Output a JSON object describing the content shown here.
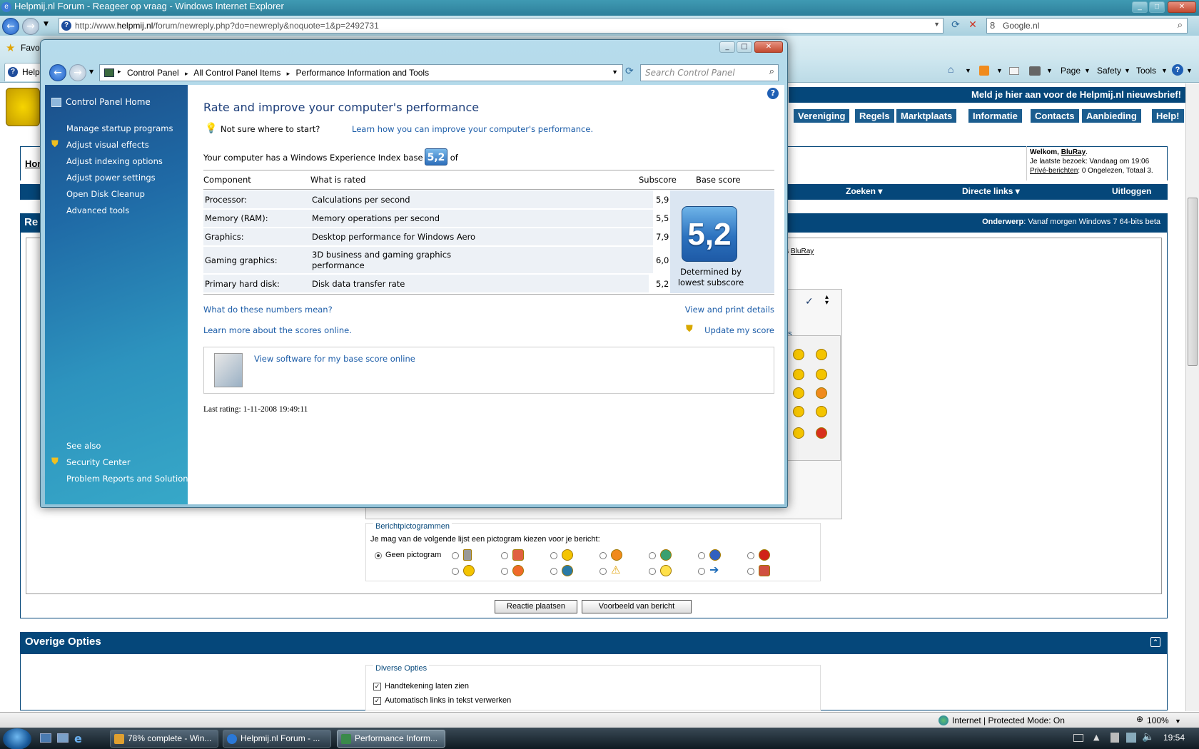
{
  "browser": {
    "title": "Helpmij.nl Forum - Reageer op vraag - Windows Internet Explorer",
    "url_prefix": "http://www.",
    "url_domain": "helpmij.nl",
    "url_path": "/forum/newreply.php?do=newreply&noquote=1&p=2492731",
    "search_value": "Google.nl",
    "favorites_label": "Favorites",
    "tab_label": "Helpmij",
    "commands": [
      "Page",
      "Safety",
      "Tools"
    ],
    "status_zone": "Internet | Protected Mode: On",
    "zoom": "100%"
  },
  "forum": {
    "banner": "Meld je hier aan voor de Helpmij.nl nieuwsbrief!",
    "nav": [
      "Vereniging",
      "Regels",
      "Marktplaats",
      "Informatie",
      "Contacts",
      "Aanbieding",
      "Help!"
    ],
    "home_crumb": "Hor",
    "welcome_prefix": "Welkom,",
    "welcome_user": "BluRay",
    "welcome_line2": "Je laatste bezoek: Vandaag om 19:06",
    "welcome_pm": "Privé-berichten",
    "welcome_pm_rest": ": 0 Ongelezen, Totaal 3.",
    "linkbar": [
      "Zoeken",
      "Directe links",
      "Uitloggen"
    ],
    "reply_head_left": "Re",
    "subject_label": "Onderwerp",
    "subject_value": ": Vanaf morgen Windows 7 64-bits beta",
    "is_label": "is",
    "is_user": "BluRay",
    "smilies_label": "es",
    "icons_legend": "Berichtpictogrammen",
    "icons_text": "Je mag van de volgende lijst een pictogram kiezen voor je bericht:",
    "no_icon": "Geen pictogram",
    "btn_post": "Reactie plaatsen",
    "btn_preview": "Voorbeeld van bericht",
    "options_head": "Overige Opties",
    "diverse_legend": "Diverse Opties",
    "opt1": "Handtekening laten zien",
    "opt2": "Automatisch links in tekst verwerken"
  },
  "controlpanel": {
    "breadcrumb": [
      "Control Panel",
      "All Control Panel Items",
      "Performance Information and Tools"
    ],
    "search_placeholder": "Search Control Panel",
    "left_home": "Control Panel Home",
    "left_tasks": [
      "Manage startup programs",
      "Adjust visual effects",
      "Adjust indexing options",
      "Adjust power settings",
      "Open Disk Cleanup",
      "Advanced tools"
    ],
    "see_also": "See also",
    "see_also_links": [
      "Security Center",
      "Problem Reports and Solutions"
    ],
    "heading": "Rate and improve your computer's performance",
    "tip_text": "Not sure where to start?",
    "tip_link": "Learn how you can improve your computer's performance.",
    "base_text": "Your computer has a Windows Experience Index base score of",
    "base_score": "5,2",
    "col_component": "Component",
    "col_rated": "What is rated",
    "col_subscore": "Subscore",
    "col_base": "Base score",
    "rows": [
      {
        "component": "Processor:",
        "rated": "Calculations per second",
        "rated2": "",
        "subscore": "5,9"
      },
      {
        "component": "Memory (RAM):",
        "rated": "Memory operations per second",
        "rated2": "",
        "subscore": "5,5"
      },
      {
        "component": "Graphics:",
        "rated": "Desktop performance for Windows Aero",
        "rated2": "",
        "subscore": "7,9"
      },
      {
        "component": "Gaming graphics:",
        "rated": "3D business and gaming graphics",
        "rated2": "performance",
        "subscore": "6,0"
      },
      {
        "component": "Primary hard disk:",
        "rated": "Disk data transfer rate",
        "rated2": "",
        "subscore": "5,2"
      }
    ],
    "determined": "Determined by",
    "lowest": "lowest subscore",
    "link_numbers": "What do these numbers mean?",
    "link_print": "View and print details",
    "link_learn": "Learn more about the scores online.",
    "link_update": "Update my score",
    "link_software": "View software for my base score online",
    "last_rating": "Last rating: 1-11-2008 19:49:11"
  },
  "taskbar": {
    "items": [
      "78% complete - Win...",
      "Helpmij.nl Forum - ...",
      "Performance Inform..."
    ],
    "clock": "19:54"
  }
}
